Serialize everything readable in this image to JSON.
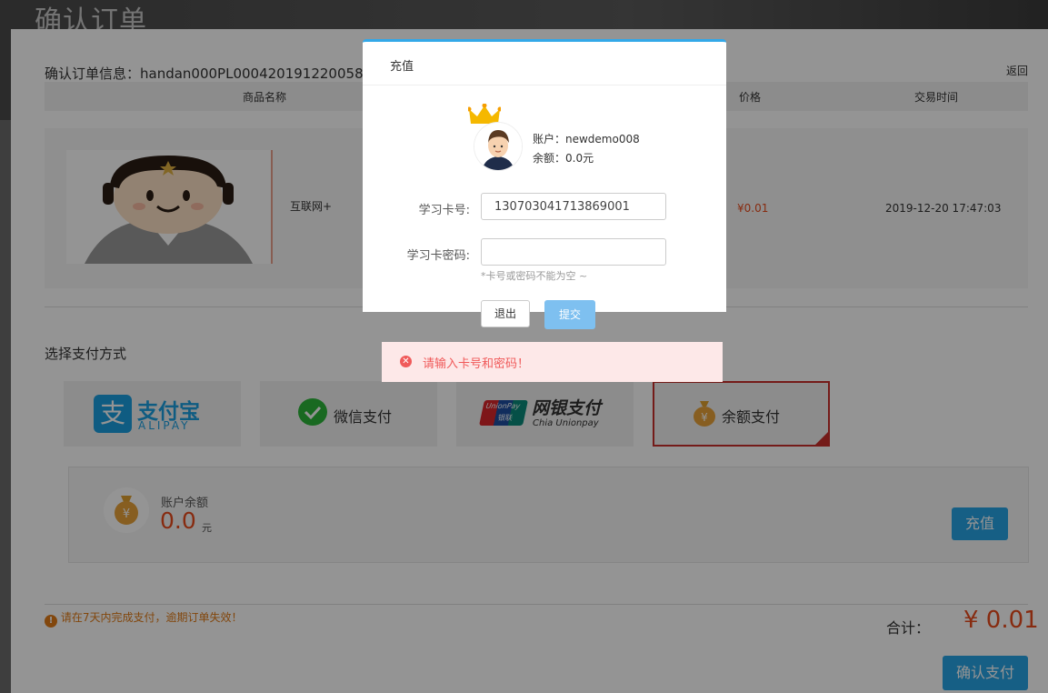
{
  "page": {
    "title": "确认订单"
  },
  "order": {
    "info_label": "确认订单信息：handan000PL000420191220058",
    "back": "返回",
    "columns": [
      "商品名称",
      "价格",
      "交易时间"
    ],
    "item": {
      "name": "互联网+",
      "price": "¥0.01",
      "time": "2019-12-20 17:47:03"
    }
  },
  "payment": {
    "section_title": "选择支付方式",
    "methods": [
      {
        "label": "支付宝",
        "sub": "ALIPAY",
        "icon": "alipay-icon"
      },
      {
        "label": "微信支付",
        "icon": "wechat-icon"
      },
      {
        "label": "网银支付",
        "sub": "Chia Unionpay",
        "icon": "unionpay-icon",
        "badge1": "UnionPay",
        "badge2": "银联"
      },
      {
        "label": "余额支付",
        "icon": "money-bag-icon",
        "selected": true
      }
    ],
    "balance": {
      "label": "账户余额",
      "amount": "0.0",
      "unit": "元",
      "recharge": "充值"
    }
  },
  "footer": {
    "notice": "请在7天内完成支付，逾期订单失效！",
    "total_label": "合计：",
    "total_value": "¥ 0.01",
    "confirm": "确认支付"
  },
  "modal": {
    "title": "充值",
    "account": "账户：newdemo008",
    "balance": "余额：0.0元",
    "card_label": "学习卡号:",
    "card_value": "130703041713869001",
    "pwd_label": "学习卡密码:",
    "pwd_value": "",
    "hint": "*卡号或密码不能为空 ~",
    "exit": "退出",
    "submit": "提交"
  },
  "error": {
    "message": "请输入卡号和密码！"
  },
  "colors": {
    "accent": "#27a4e6",
    "price": "#e84b1c",
    "error": "#f05a5a",
    "selected_border": "#c9302c"
  }
}
